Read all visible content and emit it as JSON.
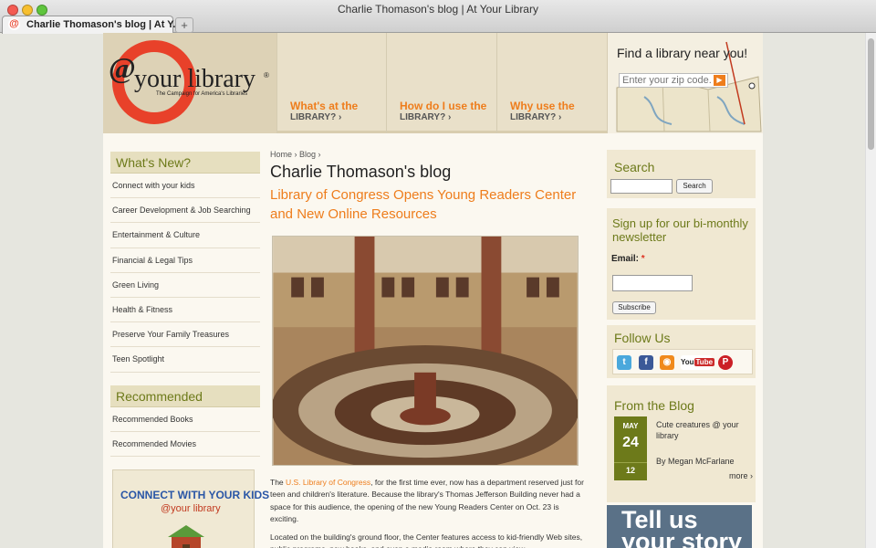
{
  "window": {
    "title": "Charlie Thomason's blog | At Your Library"
  },
  "tab": {
    "label": "Charlie Thomason's blog | At Y..."
  },
  "logo": {
    "at": "@",
    "text": "your library",
    "reg": "®",
    "tagline": "The Campaign for America's Libraries"
  },
  "nav": [
    {
      "top": "What's at the",
      "bottom": "LIBRARY? ›"
    },
    {
      "top": "How do I use the",
      "bottom": "LIBRARY? ›"
    },
    {
      "top": "Why use the",
      "bottom": "LIBRARY? ›"
    }
  ],
  "find_library": {
    "title": "Find a library near you!",
    "placeholder": "Enter your zip code."
  },
  "sidebar": {
    "whats_new_title": "What's New?",
    "whats_new": [
      "Connect with your kids",
      "Career Development & Job Searching",
      "Entertainment & Culture",
      "Financial & Legal Tips",
      "Green Living",
      "Health & Fitness",
      "Preserve Your Family Treasures",
      "Teen Spotlight"
    ],
    "recommended_title": "Recommended",
    "recommended": [
      "Recommended Books",
      "Recommended Movies"
    ],
    "promo_line1": "CONNECT WITH YOUR KIDS",
    "promo_line2": "@your library"
  },
  "main": {
    "breadcrumb": "Home › Blog ›",
    "blog_title": "Charlie Thomason's blog",
    "post_title": "Library of Congress Opens Young Readers Center and New Online Resources",
    "p1_before": "The ",
    "p1_link": "U.S. Library of Congress",
    "p1_after": ", for the first time ever, now has a department reserved just for teen and children's literature. Because the library's Thomas Jefferson Building never had a space for this audience, the opening of the new Young Readers Center on Oct. 23 is exciting.",
    "p2": "Located on the building's ground floor, the Center features access to kid-friendly Web sites, public programs, new books, and even a media room where they can view"
  },
  "right": {
    "search_title": "Search",
    "search_button": "Search",
    "newsletter_title": "Sign up for our bi-monthly newsletter",
    "email_label": "Email:",
    "email_required": "*",
    "subscribe_button": "Subscribe",
    "follow_title": "Follow Us",
    "social": {
      "twitter": "t",
      "facebook": "f",
      "rss": "◉",
      "youtube_a": "You",
      "youtube_b": "Tube",
      "pinterest": "P"
    },
    "blog_title": "From the Blog",
    "date": {
      "month": "MAY",
      "day": "24",
      "yr": "12"
    },
    "blog_post": "Cute creatures @ your library",
    "blog_author": "By Megan McFarlane",
    "blog_more": "more ›",
    "tellus": "Tell us your story"
  }
}
